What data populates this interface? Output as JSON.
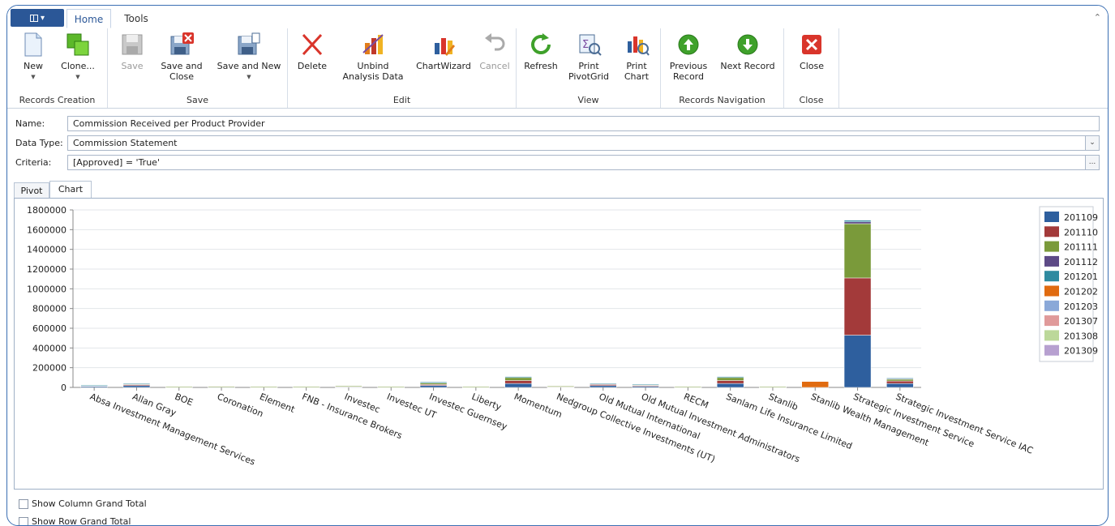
{
  "tabs": {
    "home": "Home",
    "tools": "Tools"
  },
  "ribbon": {
    "groups": {
      "records_creation": "Records Creation",
      "save": "Save",
      "edit": "Edit",
      "view": "View",
      "records_navigation": "Records Navigation",
      "close": "Close"
    },
    "buttons": {
      "new": "New",
      "clone": "Clone...",
      "save": "Save",
      "save_and_close_1": "Save and",
      "save_and_close_2": "Close",
      "save_and_new": "Save and New",
      "delete": "Delete",
      "unbind_1": "Unbind",
      "unbind_2": "Analysis Data",
      "chartwizard": "ChartWizard",
      "cancel": "Cancel",
      "refresh": "Refresh",
      "print_pivotgrid_1": "Print",
      "print_pivotgrid_2": "PivotGrid",
      "print_chart_1": "Print",
      "print_chart_2": "Chart",
      "previous_record_1": "Previous",
      "previous_record_2": "Record",
      "next_record": "Next Record",
      "close": "Close"
    }
  },
  "fields": {
    "name_label": "Name:",
    "name_value": "Commission Received per Product Provider",
    "datatype_label": "Data Type:",
    "datatype_value": "Commission Statement",
    "criteria_label": "Criteria:",
    "criteria_value": "[Approved] = 'True'",
    "criteria_button": "..."
  },
  "view_tabs": {
    "pivot": "Pivot",
    "chart": "Chart"
  },
  "checkboxes": {
    "column_total": "Show Column Grand Total",
    "row_total": "Show Row Grand Total"
  },
  "colors": {
    "accent": "#2b5797",
    "border": "#3b6fb3"
  },
  "chart_data": {
    "type": "bar",
    "stacked": true,
    "ylim": [
      0,
      1800000
    ],
    "yticks": [
      0,
      200000,
      400000,
      600000,
      800000,
      1000000,
      1200000,
      1400000,
      1600000,
      1800000
    ],
    "legend_position": "top-right",
    "categories": [
      "Absa Investment Management Services",
      "Allan Gray",
      "BOE",
      "Coronation",
      "Element",
      "FNB - Insurance Brokers",
      "Investec",
      "Investec UT",
      "Investec Guernsey",
      "Liberty",
      "Momentum",
      "Nedgroup Collective Investments (UT)",
      "Old Mutual International",
      "Old Mutual Investment Administrators",
      "RECM",
      "Sanlam Life Insurance Limited",
      "Stanlib",
      "Stanlib Wealth Management",
      "Strategic Investment Service",
      "Strategic Investment Service IAC"
    ],
    "series": [
      {
        "name": "201109",
        "color": "#2e5f9e",
        "values": [
          12000,
          18000,
          3000,
          5000,
          3000,
          3000,
          7000,
          3000,
          20000,
          3000,
          40000,
          6000,
          18000,
          12000,
          3000,
          40000,
          3000,
          0,
          530000,
          40000
        ]
      },
      {
        "name": "201110",
        "color": "#a33a3a",
        "values": [
          6000,
          12000,
          2000,
          4000,
          2000,
          2000,
          4000,
          2000,
          10000,
          2000,
          30000,
          4000,
          12000,
          8000,
          2000,
          30000,
          2000,
          0,
          580000,
          25000
        ]
      },
      {
        "name": "201111",
        "color": "#7a9a3a",
        "values": [
          4000,
          6000,
          1000,
          2000,
          1000,
          1000,
          3000,
          1000,
          15000,
          1000,
          30000,
          3000,
          8000,
          8000,
          1000,
          30000,
          1000,
          0,
          550000,
          20000
        ]
      },
      {
        "name": "201112",
        "color": "#5d4a86",
        "values": [
          0,
          0,
          0,
          0,
          0,
          0,
          0,
          0,
          0,
          0,
          0,
          0,
          0,
          0,
          0,
          0,
          0,
          0,
          20000,
          5000
        ]
      },
      {
        "name": "201201",
        "color": "#2f8aa0",
        "values": [
          2000,
          4000,
          0,
          0,
          0,
          0,
          0,
          0,
          10000,
          0,
          10000,
          0,
          2000,
          4000,
          0,
          10000,
          0,
          0,
          15000,
          5000
        ]
      },
      {
        "name": "201202",
        "color": "#e06b10",
        "values": [
          0,
          0,
          0,
          0,
          0,
          0,
          0,
          0,
          0,
          0,
          0,
          0,
          0,
          0,
          0,
          0,
          0,
          60000,
          0,
          0
        ]
      },
      {
        "name": "201203",
        "color": "#8aa8d8",
        "values": [
          0,
          0,
          0,
          0,
          0,
          0,
          0,
          0,
          0,
          0,
          0,
          0,
          0,
          0,
          0,
          0,
          0,
          0,
          0,
          0
        ]
      },
      {
        "name": "201307",
        "color": "#e09a9a",
        "values": [
          0,
          0,
          0,
          0,
          0,
          0,
          0,
          0,
          0,
          0,
          0,
          0,
          0,
          0,
          0,
          0,
          0,
          0,
          0,
          0
        ]
      },
      {
        "name": "201308",
        "color": "#bcd89a",
        "values": [
          0,
          0,
          0,
          0,
          0,
          0,
          0,
          0,
          0,
          0,
          0,
          0,
          0,
          0,
          0,
          0,
          0,
          0,
          0,
          0
        ]
      },
      {
        "name": "201309",
        "color": "#b7a0d0",
        "values": [
          0,
          0,
          0,
          0,
          0,
          0,
          0,
          0,
          0,
          0,
          0,
          0,
          0,
          0,
          0,
          0,
          0,
          0,
          0,
          0
        ]
      }
    ]
  }
}
